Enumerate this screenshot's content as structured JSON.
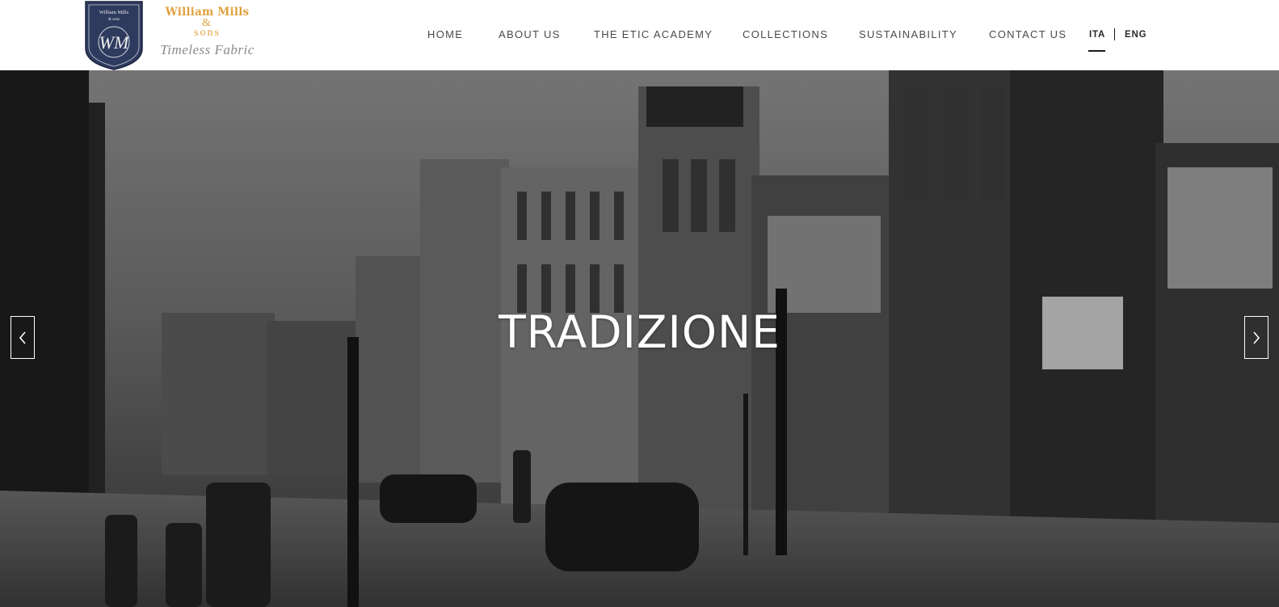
{
  "brand": {
    "crest_monogram": "WM",
    "crest_title": "William Mills",
    "crest_sons": "& sons",
    "name": "William Mills",
    "ampersand": "&",
    "sons": "sons",
    "tagline": "Timeless Fabric",
    "gold_color": "#e0a13e",
    "crest_color": "#2f3b5e"
  },
  "nav": {
    "items": [
      {
        "label": "HOME"
      },
      {
        "label": "ABOUT US"
      },
      {
        "label": "THE ETIC ACADEMY"
      },
      {
        "label": "COLLECTIONS"
      },
      {
        "label": "SUSTAINABILITY"
      },
      {
        "label": "CONTACT US"
      }
    ]
  },
  "language": {
    "active": "ITA",
    "options": [
      {
        "label": "ITA"
      },
      {
        "label": "ENG"
      }
    ]
  },
  "hero": {
    "title": "TRADIZIONE",
    "prev_icon": "chevron-left-icon",
    "next_icon": "chevron-right-icon"
  }
}
